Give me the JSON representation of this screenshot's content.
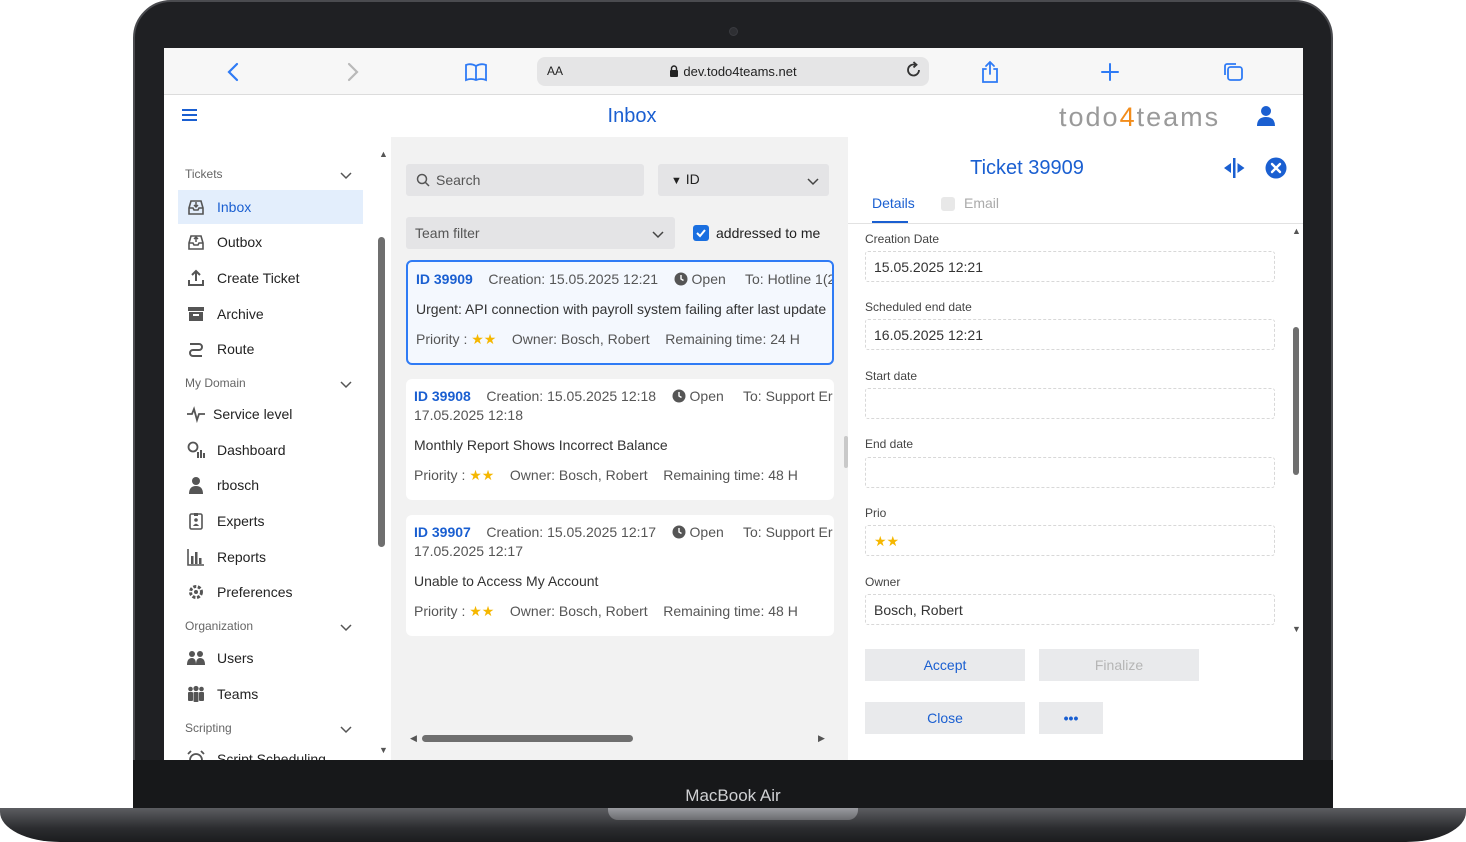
{
  "device": {
    "label": "MacBook Air"
  },
  "browser": {
    "text_size_label": "AA",
    "url": "dev.todo4teams.net",
    "icons": [
      "back-icon",
      "forward-icon",
      "bookmarks-icon",
      "lock-icon",
      "reload-icon",
      "share-icon",
      "new-tab-icon",
      "tabs-icon"
    ]
  },
  "header": {
    "title": "Inbox",
    "brand_pre": "todo",
    "brand_num": "4",
    "brand_post": "teams"
  },
  "sidebar": {
    "sections": [
      "Tickets",
      "My Domain",
      "Organization",
      "Scripting"
    ],
    "items": [
      {
        "label": "Inbox",
        "icon": "inbox-icon",
        "active": true
      },
      {
        "label": "Outbox",
        "icon": "outbox-icon"
      },
      {
        "label": "Create Ticket",
        "icon": "upload-icon"
      },
      {
        "label": "Archive",
        "icon": "archive-icon"
      },
      {
        "label": "Route",
        "icon": "route-icon"
      },
      {
        "label": "Service level",
        "icon": "pulse-icon"
      },
      {
        "label": "Dashboard",
        "icon": "dashboard-icon"
      },
      {
        "label": "rbosch",
        "icon": "user-icon"
      },
      {
        "label": "Experts",
        "icon": "id-badge-icon"
      },
      {
        "label": "Reports",
        "icon": "bar-chart-icon"
      },
      {
        "label": "Preferences",
        "icon": "gear-icon"
      },
      {
        "label": "Users",
        "icon": "users-icon"
      },
      {
        "label": "Teams",
        "icon": "teams-icon"
      },
      {
        "label": "Script Scheduling",
        "icon": "alarm-icon"
      }
    ]
  },
  "list": {
    "search_placeholder": "Search",
    "sort_label": "ID",
    "team_filter_placeholder": "Team filter",
    "addressed_to_me_label": "addressed to me",
    "addressed_to_me_checked": true,
    "tickets": [
      {
        "id": "ID 39909",
        "creation": "Creation: 15.05.2025 12:21",
        "status": "Open",
        "to": "To: Hotline 1(2",
        "second_line": "",
        "title": "Urgent: API connection with payroll system failing after last update",
        "priority_label": "Priority :",
        "stars": "★★",
        "owner": "Owner: Bosch, Robert",
        "remaining": "Remaining time: 24 H",
        "selected": true
      },
      {
        "id": "ID 39908",
        "creation": "Creation: 15.05.2025 12:18",
        "status": "Open",
        "to": "To: Support Er",
        "second_line": "17.05.2025 12:18",
        "title": "Monthly Report Shows Incorrect Balance",
        "priority_label": "Priority :",
        "stars": "★★",
        "owner": "Owner: Bosch, Robert",
        "remaining": "Remaining time: 48 H",
        "selected": false
      },
      {
        "id": "ID 39907",
        "creation": "Creation: 15.05.2025 12:17",
        "status": "Open",
        "to": "To: Support Er",
        "second_line": "17.05.2025 12:17",
        "title": "Unable to Access My Account",
        "priority_label": "Priority :",
        "stars": "★★",
        "owner": "Owner: Bosch, Robert",
        "remaining": "Remaining time: 48 H",
        "selected": false
      }
    ]
  },
  "detail": {
    "title": "Ticket 39909",
    "tabs": {
      "details": "Details",
      "email": "Email"
    },
    "fields": [
      {
        "label": "Creation Date",
        "value": "15.05.2025 12:21"
      },
      {
        "label": "Scheduled end date",
        "value": "16.05.2025 12:21"
      },
      {
        "label": "Start date",
        "value": ""
      },
      {
        "label": "End date",
        "value": ""
      },
      {
        "label": "Prio",
        "value": "★★"
      },
      {
        "label": "Owner",
        "value": "Bosch, Robert"
      }
    ],
    "buttons": {
      "accept": "Accept",
      "finalize": "Finalize",
      "close": "Close",
      "more": "•••"
    },
    "colors": {
      "accent": "#1a5fd1",
      "star": "#f5b700"
    }
  }
}
